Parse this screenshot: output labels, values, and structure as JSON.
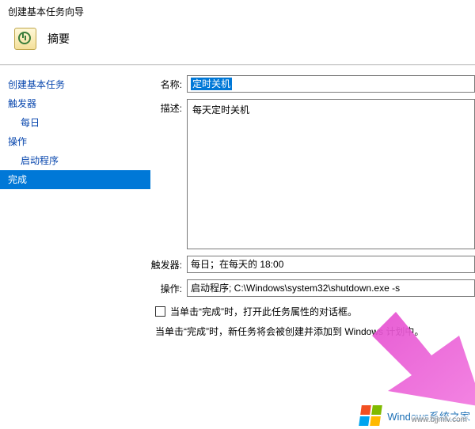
{
  "window_title": "创建基本任务向导",
  "header": {
    "title": "摘要"
  },
  "sidebar": {
    "items": [
      {
        "label": "创建基本任务",
        "indent": false
      },
      {
        "label": "触发器",
        "indent": false
      },
      {
        "label": "每日",
        "indent": true
      },
      {
        "label": "操作",
        "indent": false
      },
      {
        "label": "启动程序",
        "indent": true
      },
      {
        "label": "完成",
        "indent": false,
        "selected": true
      }
    ]
  },
  "form": {
    "name_label": "名称:",
    "name_value": "定时关机",
    "desc_label": "描述:",
    "desc_value": "每天定时关机",
    "trigger_label": "触发器:",
    "trigger_value": "每日；在每天的 18:00",
    "action_label": "操作:",
    "action_value": "启动程序; C:\\Windows\\system32\\shutdown.exe -s",
    "checkbox_label": "当单击“完成”时，打开此任务属性的对话框。",
    "note": "当单击“完成”时，新任务将会被创建并添加到 Windows 计划中。"
  },
  "watermark": {
    "brand": "Windows系统之家",
    "url": "www.bjjmlv.com"
  }
}
